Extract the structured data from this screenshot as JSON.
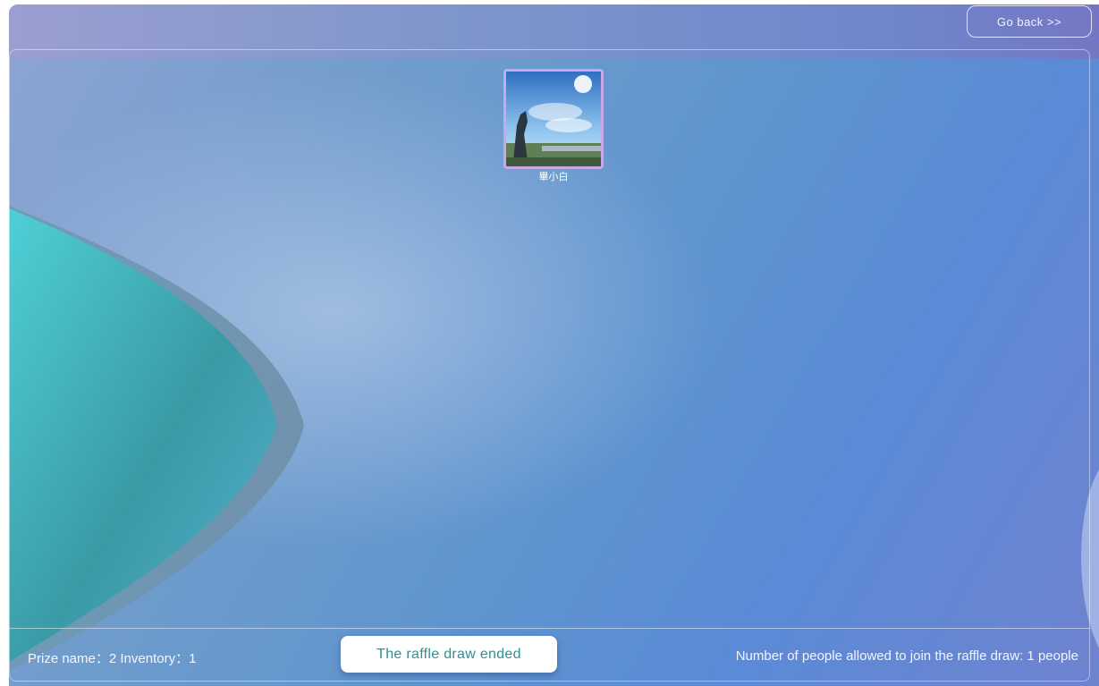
{
  "header": {
    "go_back_label": "Go back >>"
  },
  "participants": [
    {
      "name": "畢小白"
    }
  ],
  "footer": {
    "prize_info": "Prize name：2 Inventory：1",
    "status_label": "The raffle draw ended",
    "limit_info": "Number of people allowed to join the raffle draw: 1 people"
  },
  "colors": {
    "status_text": "#2f8f92",
    "avatar_border": "#c8a8ea",
    "teal_shape": "#3fc2cc"
  }
}
